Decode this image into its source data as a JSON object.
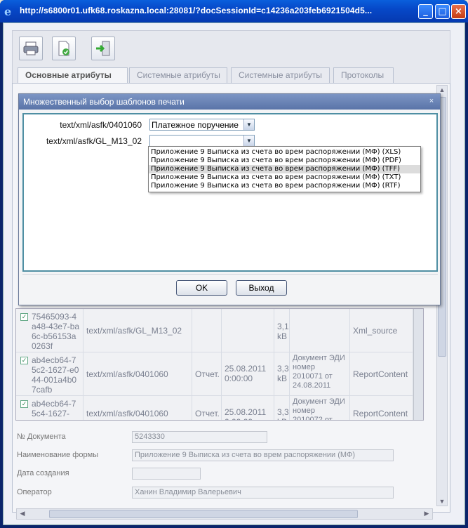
{
  "window": {
    "title": "http://s6800r01.ufk68.roskazna.local:28081/?docSessionId=c14236a203feb6921504d5...",
    "minimize_label": "_",
    "maximize_label": "□",
    "close_label": "×"
  },
  "tabs": [
    {
      "label": "Основные атрибуты"
    },
    {
      "label": "Системные атрибуты"
    },
    {
      "label": "Системные атрибуты"
    },
    {
      "label": "Протоколы"
    }
  ],
  "grid": {
    "rows": [
      {
        "checked": true,
        "id": "75465093-4a48-43e7-ba6c-b56153a0263f",
        "type": "text/xml/asfk/GL_M13_02",
        "kind": "",
        "date": "",
        "size": "3,1 kB",
        "desc": "",
        "content": "Xml_source"
      },
      {
        "checked": true,
        "id": "ab4ecb64-75c2-1627-e044-001a4b07cafb",
        "type": "text/xml/asfk/0401060",
        "kind": "Отчет.",
        "date": "25.08.2011 0:00:00",
        "size": "3,3 kB",
        "desc": "Документ ЭДИ номер 2010071 от 24.08.2011",
        "content": "ReportContent"
      },
      {
        "checked": true,
        "id": "ab4ecb64-75c4-1627-",
        "type": "text/xml/asfk/0401060",
        "kind": "Отчет.",
        "date": "25.08.2011 0:00:00",
        "size": "3,3 kB",
        "desc": "Документ ЭДИ номер 2010072 от",
        "content": "ReportContent"
      }
    ]
  },
  "form": {
    "doc_number_label": "№ Документа",
    "doc_number_value": "5243330",
    "form_name_label": "Наименование формы",
    "form_name_value": "Приложение 9 Выписка из счета во врем распоряжении (МФ)",
    "created_label": "Дата создания",
    "created_value": "",
    "operator_label": "Оператор",
    "operator_value": "Ханин Владимир  Валерьевич"
  },
  "dialog": {
    "title": "Множественный выбор шаблонов печати",
    "close_label": "×",
    "rows": [
      {
        "label": "text/xml/asfk/0401060",
        "value": "Платежное поручение"
      },
      {
        "label": "text/xml/asfk/GL_M13_02",
        "value": ""
      }
    ],
    "dropdown_options": [
      {
        "label": "Приложение 9 Выписка из счета во врем распоряжении (МФ) (XLS)",
        "selected": false
      },
      {
        "label": "Приложение 9 Выписка из счета во врем распоряжении (МФ) (PDF)",
        "selected": false
      },
      {
        "label": "Приложение 9 Выписка из счета во врем распоряжении (МФ) (TFF)",
        "selected": true
      },
      {
        "label": "Приложение 9 Выписка из счета во врем распоряжении (МФ) (TXT)",
        "selected": false
      },
      {
        "label": "Приложение 9 Выписка из счета во врем распоряжении (МФ) (RTF)",
        "selected": false
      }
    ],
    "ok_label": "OK",
    "exit_label": "Выход"
  },
  "icons": {
    "print": "printer-icon",
    "doc_check": "document-check-icon",
    "exit": "exit-door-icon",
    "browser": "internet-explorer-icon"
  }
}
